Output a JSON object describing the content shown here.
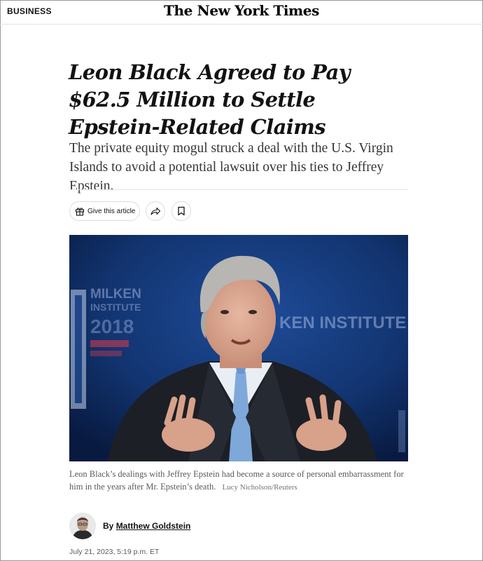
{
  "masthead": {
    "section": "BUSINESS",
    "logo": "The New York Times"
  },
  "article": {
    "headline": "Leon Black Agreed to Pay $62.5 Million to Settle Epstein-Related Claims",
    "summary": "The private equity mogul struck a deal with the U.S. Virgin Islands to avoid a potential lawsuit over his ties to Jeffrey Epstein.",
    "caption": "Leon Black’s dealings with Jeffrey Epstein had become a source of personal embarrassment for him in the years after Mr. Epstein’s death.",
    "photo_credit": "Lucy Nicholson/Reuters",
    "byline_prefix": "By",
    "author": "Matthew Goldstein",
    "timestamp": "July 21, 2023, 5:19 p.m. ET",
    "photo_backdrop_text": {
      "left_sign_line1": "MILKEN",
      "left_sign_line2": "INSTITUTE",
      "left_sign_year": "2018",
      "right_sign": "KEN INSTITUTE"
    }
  },
  "tools": {
    "gift_label": "Give this article",
    "gift_icon": "gift-icon",
    "share_icon": "share-icon",
    "save_icon": "bookmark-icon"
  },
  "colors": {
    "photo_backdrop": "#0f2a5c",
    "text": "#121212"
  }
}
